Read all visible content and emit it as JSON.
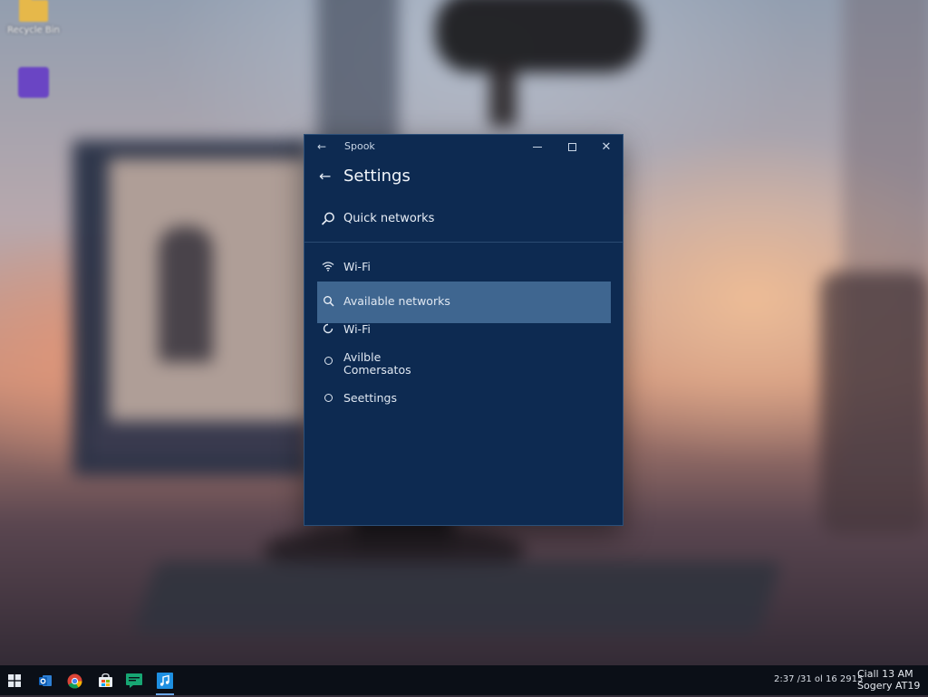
{
  "desktop": {
    "icons": [
      {
        "label": "Recycle Bin",
        "icon": "folder-icon"
      },
      {
        "label": "",
        "icon": "app-icon"
      }
    ]
  },
  "window": {
    "title": "Spook",
    "back_icon": "back-arrow-icon",
    "controls": {
      "minimize": "minimize-icon",
      "maximize": "maximize-icon",
      "close": "close-icon"
    }
  },
  "settings": {
    "header_title": "Settings",
    "search_label": "Quick networks",
    "items": [
      {
        "label": "Wi-Fi",
        "icon": "wifi-icon"
      },
      {
        "label": "Available networks",
        "icon": "search-icon",
        "selected": true
      },
      {
        "label": "Wi-Fi",
        "icon": "loading-icon"
      },
      {
        "label_line1": "Avilble",
        "label_line2": "Comersatos",
        "icon": "ring-icon"
      },
      {
        "label": "Seettings",
        "icon": "ring-icon"
      }
    ]
  },
  "taskbar": {
    "apps": [
      "start-icon",
      "outlook-icon",
      "chrome-icon",
      "store-icon",
      "chat-icon",
      "music-icon"
    ],
    "active_app": "music-icon",
    "date_text": "2:37 /31 ol 16 2915",
    "clock_line1": "Ciall 13 AM",
    "clock_line2": "Sogery AT19"
  },
  "colors": {
    "window_bg": "#0d2a51",
    "selection": "#3f6690",
    "taskbar_bg": "#0b0f17"
  }
}
